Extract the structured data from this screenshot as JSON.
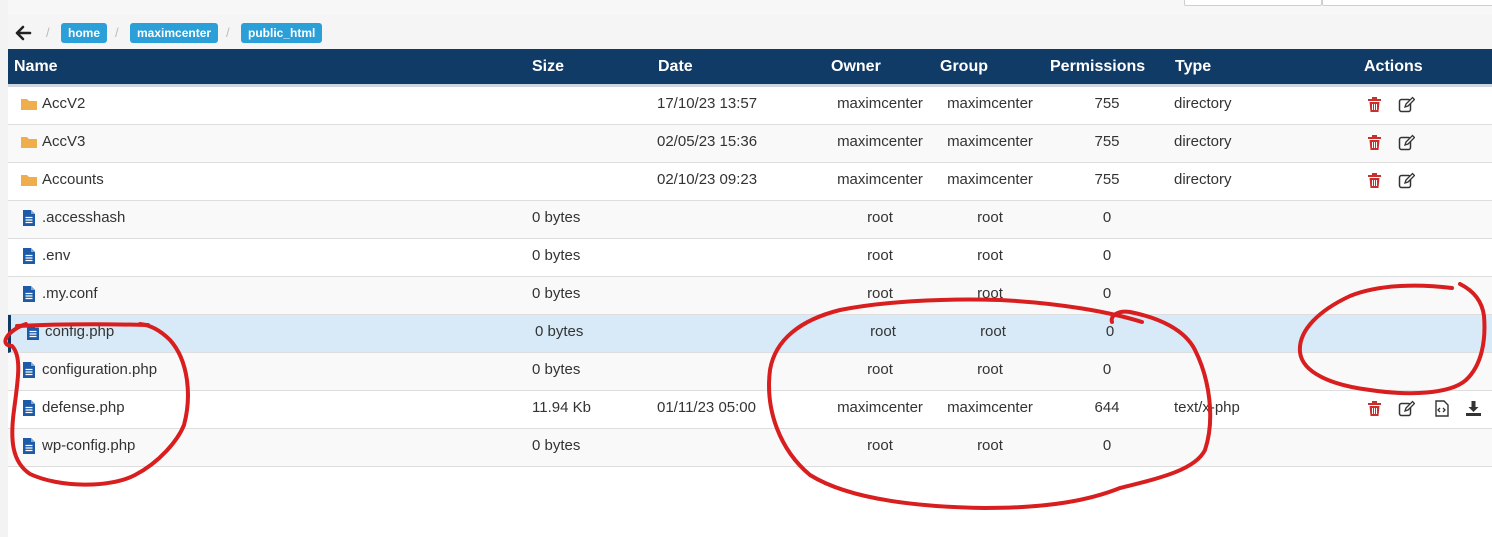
{
  "breadcrumb": {
    "items": [
      "home",
      "maximcenter",
      "public_html"
    ],
    "separator": "/"
  },
  "table": {
    "headers": {
      "name": "Name",
      "size": "Size",
      "date": "Date",
      "owner": "Owner",
      "group": "Group",
      "permissions": "Permissions",
      "type": "Type",
      "actions": "Actions"
    },
    "rows": [
      {
        "name": "AccV2",
        "kind": "folder",
        "size": "",
        "date": "17/10/23 13:57",
        "owner": "maximcenter",
        "group": "maximcenter",
        "perm": "755",
        "type": "directory",
        "actions": [
          "delete-icon",
          "edit-icon"
        ]
      },
      {
        "name": "AccV3",
        "kind": "folder",
        "size": "",
        "date": "02/05/23 15:36",
        "owner": "maximcenter",
        "group": "maximcenter",
        "perm": "755",
        "type": "directory",
        "actions": [
          "delete-icon",
          "edit-icon"
        ]
      },
      {
        "name": "Accounts",
        "kind": "folder",
        "size": "",
        "date": "02/10/23 09:23",
        "owner": "maximcenter",
        "group": "maximcenter",
        "perm": "755",
        "type": "directory",
        "actions": [
          "delete-icon",
          "edit-icon"
        ]
      },
      {
        "name": ".accesshash",
        "kind": "file",
        "size": "0 bytes",
        "date": "",
        "owner": "root",
        "group": "root",
        "perm": "0",
        "type": "",
        "actions": []
      },
      {
        "name": ".env",
        "kind": "file",
        "size": "0 bytes",
        "date": "",
        "owner": "root",
        "group": "root",
        "perm": "0",
        "type": "",
        "actions": []
      },
      {
        "name": ".my.conf",
        "kind": "file",
        "size": "0 bytes",
        "date": "",
        "owner": "root",
        "group": "root",
        "perm": "0",
        "type": "",
        "actions": []
      },
      {
        "name": "config.php",
        "kind": "file",
        "size": "0 bytes",
        "date": "",
        "owner": "root",
        "group": "root",
        "perm": "0",
        "type": "",
        "actions": [],
        "selected": true
      },
      {
        "name": "configuration.php",
        "kind": "file",
        "size": "0 bytes",
        "date": "",
        "owner": "root",
        "group": "root",
        "perm": "0",
        "type": "",
        "actions": []
      },
      {
        "name": "defense.php",
        "kind": "file",
        "size": "11.94 Kb",
        "date": "01/11/23 05:00",
        "owner": "maximcenter",
        "group": "maximcenter",
        "perm": "644",
        "type": "text/x-php",
        "actions": [
          "delete-icon",
          "edit-icon",
          "code-icon",
          "download-icon"
        ]
      },
      {
        "name": "wp-config.php",
        "kind": "file",
        "size": "0 bytes",
        "date": "",
        "owner": "root",
        "group": "root",
        "perm": "0",
        "type": "",
        "actions": []
      }
    ]
  },
  "colors": {
    "header_bg": "#103b66",
    "breadcrumb_bg": "#2a9fd8",
    "folder": "#f0ad4e",
    "file": "#1d5aa8",
    "delete": "#c9302c",
    "selected_row": "#d8eaf7",
    "annotation": "#d81e1e"
  }
}
